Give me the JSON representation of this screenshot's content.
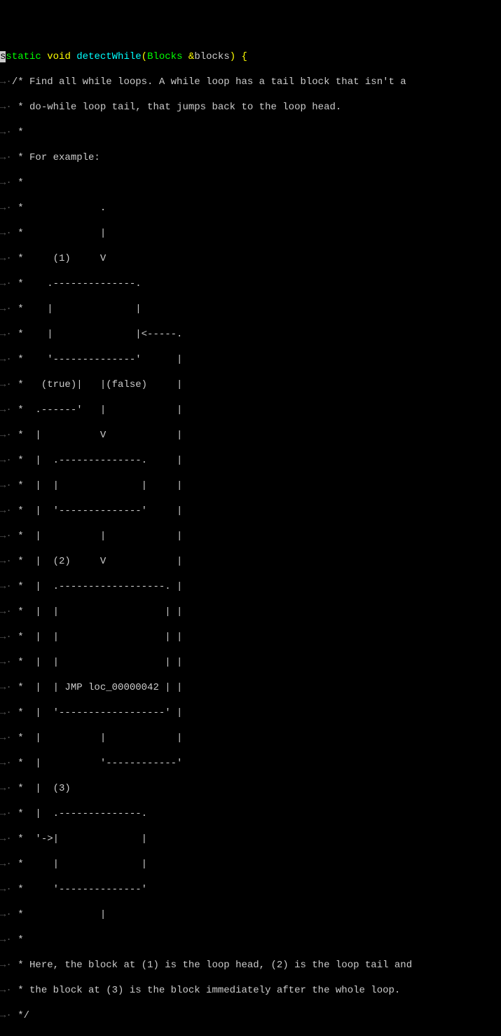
{
  "signature": {
    "static": "static",
    "void": "void",
    "func": "detectWhile",
    "lparen": "(",
    "type": "Blocks",
    "amp": "&",
    "arg": "blocks",
    "rparen": ")",
    "brace": "{"
  },
  "ws": {
    "first": "s",
    "leading": "→·",
    "leading_gap": " "
  },
  "comment": {
    "l01": "/* Find all while loops. A while loop has a tail block that isn't a",
    "l02": " * do-while loop tail, that jumps back to the loop head.",
    "l03": " *",
    "l04": " * For example:",
    "l05": " *",
    "l06": " *             .",
    "l07": " *             |",
    "l08": " *     (1)     V",
    "l09": " *    .--------------.",
    "l10": " *    |              |",
    "l11": " *    |              |<-----.",
    "l12": " *    '--------------'      |",
    "l13": " *   (true)|   |(false)     |",
    "l14": " *  .------'   |            |",
    "l15": " *  |          V            |",
    "l16": " *  |  .--------------.     |",
    "l17": " *  |  |              |     |",
    "l18": " *  |  '--------------'     |",
    "l19": " *  |          |            |",
    "l20": " *  |  (2)     V            |",
    "l21": " *  |  .------------------. |",
    "l22": " *  |  |                  | |",
    "l23": " *  |  |                  | |",
    "l24": " *  |  |                  | |",
    "l25": " *  |  | JMP loc_00000042 | |",
    "l26": " *  |  '------------------' |",
    "l27": " *  |          |            |",
    "l28": " *  |          '------------'",
    "l29": " *  |  (3)",
    "l30": " *  |  .--------------.",
    "l31": " *  '->|              |",
    "l32": " *     |              |",
    "l33": " *     '--------------'",
    "l34": " *             |",
    "l35": " *",
    "l36": " * Here, the block at (1) is the loop head, (2) is the loop tail and",
    "l37": " * the block at (3) is the block immediately after the whole loop.",
    "l38": " */"
  }
}
